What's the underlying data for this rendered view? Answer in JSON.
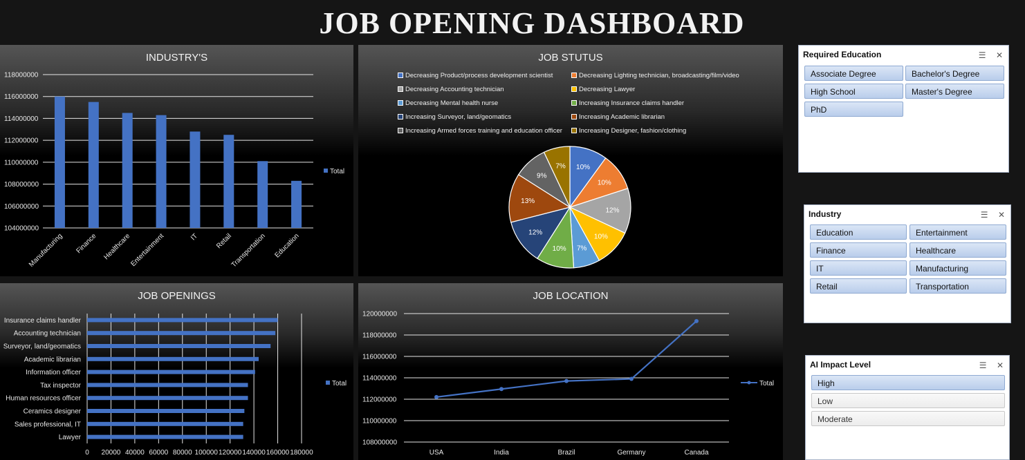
{
  "page": {
    "title": "JOB OPENING DASHBOARD"
  },
  "colors": {
    "bar": "#4472c4",
    "grid": "#e6e6e6",
    "axis_text": "#e8e8e8",
    "slicer_selected": "#b9cdeb"
  },
  "chart_data": [
    {
      "id": "industry",
      "type": "bar",
      "title": "INDUSTRY'S",
      "categories": [
        "Manufacturing",
        "Finance",
        "Healthcare",
        "Entertainment",
        "IT",
        "Retail",
        "Transportation",
        "Education"
      ],
      "series": [
        {
          "name": "Total",
          "values": [
            116000000,
            115500000,
            114500000,
            114300000,
            112800000,
            112500000,
            110100000,
            108300000
          ]
        }
      ],
      "yticks": [
        "104000000",
        "106000000",
        "108000000",
        "110000000",
        "112000000",
        "114000000",
        "116000000",
        "118000000"
      ],
      "ylim": [
        104000000,
        118000000
      ],
      "grid": true,
      "legend": "right"
    },
    {
      "id": "status",
      "type": "pie",
      "title": "JOB STUTUS",
      "slices": [
        {
          "label": "Decreasing Product/process development scientist",
          "value": 10,
          "display": "10%",
          "color": "#4472c4"
        },
        {
          "label": "Decreasing Lighting technician, broadcasting/film/video",
          "value": 10,
          "display": "10%",
          "color": "#ed7d31"
        },
        {
          "label": "Decreasing Accounting technician",
          "value": 12,
          "display": "12%",
          "color": "#a5a5a5"
        },
        {
          "label": "Decreasing Lawyer",
          "value": 10,
          "display": "10%",
          "color": "#ffc000"
        },
        {
          "label": "Decreasing Mental health nurse",
          "value": 7,
          "display": "7%",
          "color": "#5b9bd5"
        },
        {
          "label": "Increasing Insurance claims handler",
          "value": 10,
          "display": "10%",
          "color": "#70ad47"
        },
        {
          "label": "Increasing Surveyor, land/geomatics",
          "value": 12,
          "display": "12%",
          "color": "#264478"
        },
        {
          "label": "Increasing Academic librarian",
          "value": 13,
          "display": "13%",
          "color": "#9e480e"
        },
        {
          "label": "Increasing Armed forces training and education officer",
          "value": 9,
          "display": "9%",
          "color": "#636363"
        },
        {
          "label": "Increasing Designer, fashion/clothing",
          "value": 7,
          "display": "7%",
          "color": "#997300"
        }
      ],
      "legend": "top"
    },
    {
      "id": "openings",
      "type": "bar",
      "orientation": "horizontal",
      "title": "JOB OPENINGS",
      "categories": [
        "Insurance claims handler",
        "Accounting technician",
        "Surveyor, land/geomatics",
        "Academic librarian",
        "Information officer",
        "Tax inspector",
        "Human resources officer",
        "Ceramics designer",
        "Sales professional, IT",
        "Lawyer"
      ],
      "series": [
        {
          "name": "Total",
          "values": [
            160000,
            158000,
            154000,
            144000,
            141000,
            135000,
            135000,
            132000,
            131000,
            131000
          ]
        }
      ],
      "xticks": [
        "0",
        "20000",
        "40000",
        "60000",
        "80000",
        "100000",
        "120000",
        "140000",
        "160000",
        "180000"
      ],
      "xlim": [
        0,
        180000
      ],
      "grid": true,
      "legend": "right"
    },
    {
      "id": "location",
      "type": "line",
      "title": "JOB LOCATION",
      "categories": [
        "USA",
        "India",
        "Brazil",
        "Germany",
        "Canada"
      ],
      "series": [
        {
          "name": "Total",
          "values": [
            112200000,
            112950000,
            113700000,
            113900000,
            119300000
          ]
        }
      ],
      "yticks": [
        "108000000",
        "110000000",
        "112000000",
        "114000000",
        "116000000",
        "118000000",
        "120000000"
      ],
      "ylim": [
        108000000,
        120000000
      ],
      "grid": true,
      "legend": "right"
    }
  ],
  "slicers": {
    "education": {
      "title": "Required Education",
      "items": [
        "Associate Degree",
        "Bachelor's Degree",
        "High School",
        "Master's Degree",
        "PhD"
      ]
    },
    "industry": {
      "title": "Industry",
      "items": [
        "Education",
        "Entertainment",
        "Finance",
        "Healthcare",
        "IT",
        "Manufacturing",
        "Retail",
        "Transportation"
      ]
    },
    "ai": {
      "title": "AI Impact Level",
      "items": [
        "High",
        "Low",
        "Moderate"
      ],
      "selected": [
        true,
        false,
        false
      ]
    }
  }
}
